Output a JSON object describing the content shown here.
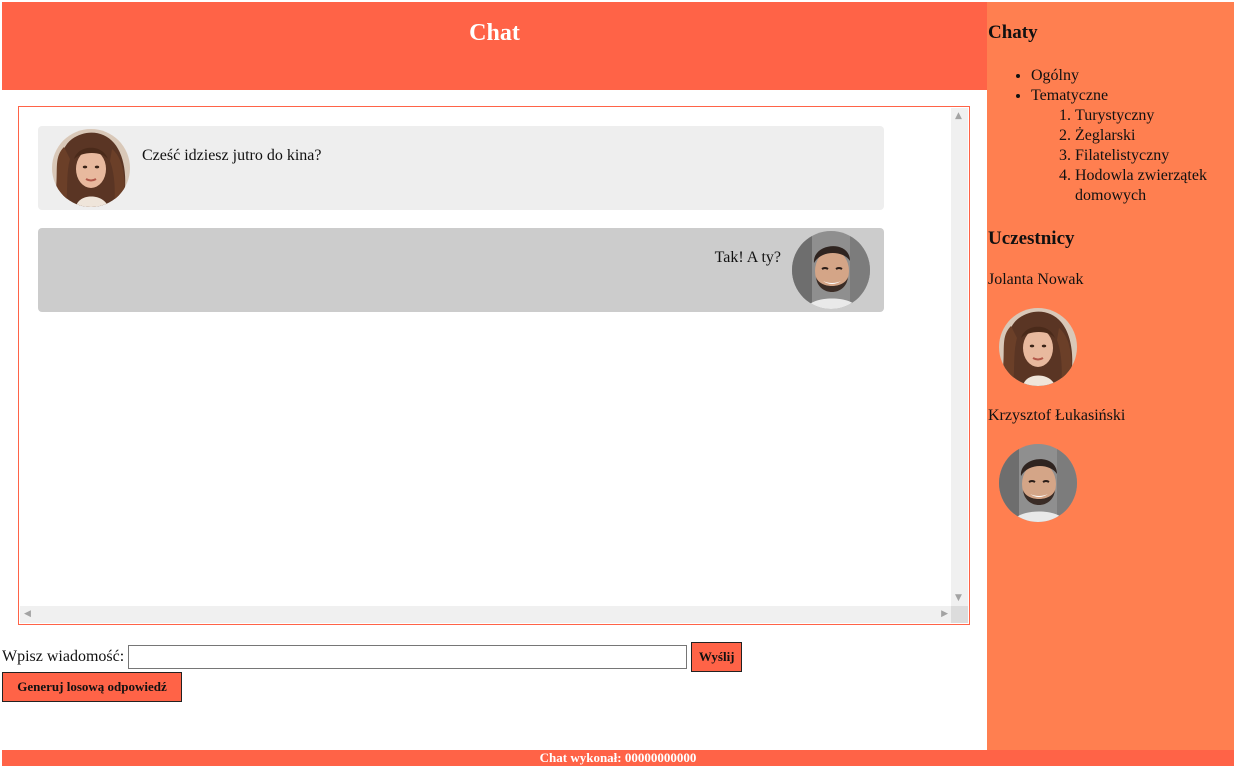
{
  "header": {
    "title": "Chat"
  },
  "messages": [
    {
      "text": "Cześć idziesz jutro do kina?",
      "author": "Jolanta Nowak",
      "side": "left"
    },
    {
      "text": "Tak! A ty?",
      "author": "Krzysztof Łukasiński",
      "side": "right"
    }
  ],
  "input": {
    "label": "Wpisz wiadomość:",
    "value": "",
    "placeholder": ""
  },
  "buttons": {
    "send": "Wyślij",
    "random": "Generuj losową odpowiedź"
  },
  "sidebar": {
    "chats_title": "Chaty",
    "chats": [
      {
        "label": "Ogólny"
      },
      {
        "label": "Tematyczne",
        "children": [
          {
            "label": "Turystyczny"
          },
          {
            "label": "Żeglarski"
          },
          {
            "label": "Filatelistyczny"
          },
          {
            "label": "Hodowla zwierzątek domowych"
          }
        ]
      }
    ],
    "participants_title": "Uczestnicy",
    "participants": [
      {
        "name": "Jolanta Nowak"
      },
      {
        "name": "Krzysztof Łukasiński"
      }
    ]
  },
  "footer": {
    "text": "Chat wykonał: 00000000000"
  },
  "colors": {
    "header": "#ff6347",
    "sidebar": "#ff7f50",
    "message_left": "#eeeeee",
    "message_right": "#cccccc"
  }
}
